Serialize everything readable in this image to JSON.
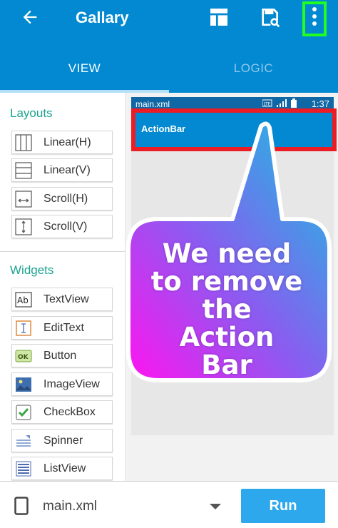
{
  "appbar": {
    "title": "Gallary",
    "icons": [
      "back-arrow-icon",
      "layout-icon",
      "save-icon",
      "overflow-menu-icon"
    ],
    "highlight_color": "#21ff21"
  },
  "tabs": [
    {
      "label": "VIEW",
      "active": true
    },
    {
      "label": "LOGIC",
      "active": false
    }
  ],
  "palette": {
    "layouts_title": "Layouts",
    "layouts": [
      {
        "label": "Linear(H)",
        "icon": "linear-horizontal-icon"
      },
      {
        "label": "Linear(V)",
        "icon": "linear-vertical-icon"
      },
      {
        "label": "Scroll(H)",
        "icon": "scroll-horizontal-icon"
      },
      {
        "label": "Scroll(V)",
        "icon": "scroll-vertical-icon"
      }
    ],
    "widgets_title": "Widgets",
    "widgets": [
      {
        "label": "TextView",
        "icon": "textview-icon"
      },
      {
        "label": "EditText",
        "icon": "edittext-icon"
      },
      {
        "label": "Button",
        "icon": "button-icon"
      },
      {
        "label": "ImageView",
        "icon": "imageview-icon"
      },
      {
        "label": "CheckBox",
        "icon": "checkbox-icon"
      },
      {
        "label": "Spinner",
        "icon": "spinner-icon"
      },
      {
        "label": "ListView",
        "icon": "listview-icon"
      }
    ]
  },
  "preview": {
    "status_file": "main.xml",
    "status_time": "1:37",
    "actionbar_title": "ActionBar",
    "highlight_color": "#ec1c24"
  },
  "annotation": {
    "lines": [
      "We need",
      "to remove",
      "the",
      "Action",
      "Bar"
    ]
  },
  "bottombar": {
    "file_name": "main.xml",
    "run_label": "Run"
  },
  "colors": {
    "primary": "#0289d1",
    "accent": "#2ea8ec",
    "section_title": "#1ba38f"
  }
}
